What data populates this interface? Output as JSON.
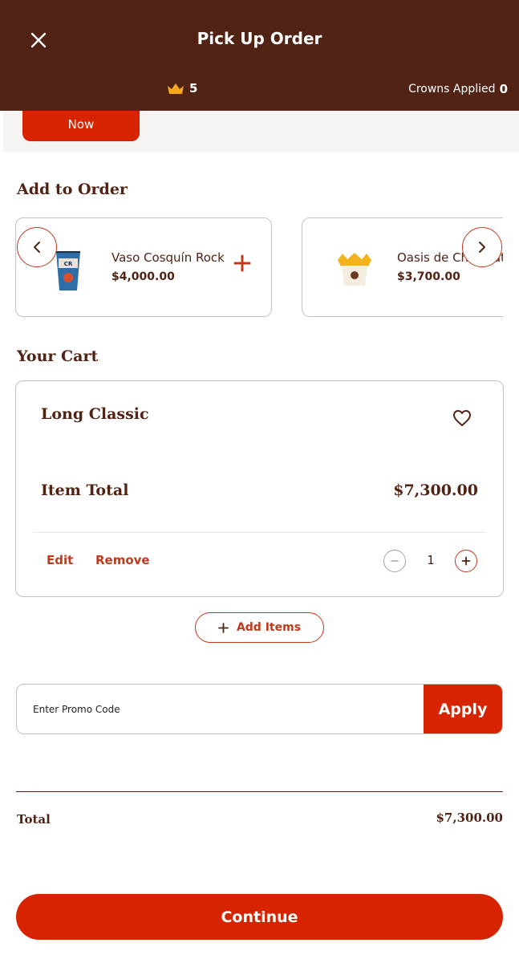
{
  "header": {
    "title": "Pick Up Order",
    "crowns_balance": "5",
    "crowns_applied_label": "Crowns Applied",
    "crowns_applied_value": "0",
    "close_icon": "close-icon",
    "crown_icon": "crown-icon"
  },
  "banner": {
    "now_label": "Now"
  },
  "add_to_order": {
    "title": "Add to Order",
    "items": [
      {
        "name": "Vaso Cosquín Rock",
        "price": "$4,000.00",
        "icon": "cup-image"
      },
      {
        "name": "Oasis de Chocolate",
        "price": "$3,700.00",
        "icon": "dessert-cup-image"
      }
    ]
  },
  "cart": {
    "title": "Your Cart",
    "item": {
      "name": "Long Classic",
      "total_label": "Item Total",
      "total_value": "$7,300.00",
      "edit_label": "Edit",
      "remove_label": "Remove",
      "quantity": "1"
    }
  },
  "add_items": {
    "label": "Add Items"
  },
  "promo": {
    "placeholder": "Enter Promo Code",
    "value": "",
    "apply_label": "Apply"
  },
  "totals": {
    "label": "Total",
    "value": "$7,300.00"
  },
  "footer": {
    "continue_label": "Continue"
  },
  "colors": {
    "brand_brown": "#502314",
    "brand_red": "#d62300",
    "accent_orange": "#f5a623"
  }
}
